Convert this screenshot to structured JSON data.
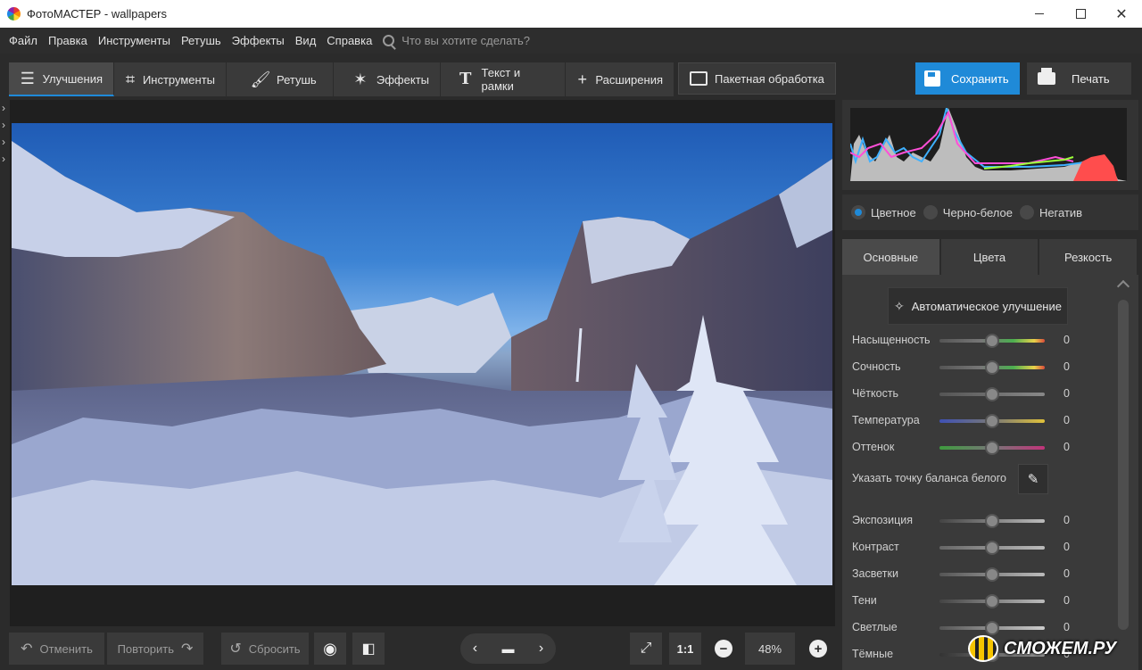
{
  "window": {
    "title": "ФотоМАСТЕР - wallpapers"
  },
  "menu": {
    "items": [
      "Файл",
      "Правка",
      "Инструменты",
      "Ретушь",
      "Эффекты",
      "Вид",
      "Справка"
    ],
    "search_placeholder": "Что вы хотите сделать?"
  },
  "tabs": [
    {
      "label": "Улучшения",
      "icon": "sliders-icon",
      "active": true
    },
    {
      "label": "Инструменты",
      "icon": "crop-icon"
    },
    {
      "label": "Ретушь",
      "icon": "brush-icon"
    },
    {
      "label": "Эффекты",
      "icon": "magic-wand-icon"
    },
    {
      "label": "Текст и рамки",
      "icon": "text-icon"
    },
    {
      "label": "Расширения",
      "icon": "plus-icon"
    }
  ],
  "toolbar": {
    "batch_label": "Пакетная обработка",
    "save_label": "Сохранить",
    "print_label": "Печать",
    "accent_color": "#1f8ad8"
  },
  "bottom": {
    "undo_label": "Отменить",
    "redo_label": "Повторить",
    "reset_label": "Сбросить",
    "ratio_label": "1:1",
    "zoom_value": "48%"
  },
  "panel": {
    "modes": [
      {
        "label": "Цветное",
        "selected": true
      },
      {
        "label": "Черно-белое",
        "selected": false
      },
      {
        "label": "Негатив",
        "selected": false
      }
    ],
    "tabs": [
      "Основные",
      "Цвета",
      "Резкость"
    ],
    "auto_label": "Автоматическое улучшение",
    "white_balance_label": "Указать точку баланса белого",
    "color_sliders": [
      {
        "label": "Насыщенность",
        "value": "0",
        "gradient": "linear-gradient(90deg,#555,#777 40%,#4caf50 70%,#e8d14a 90%,#d94a3a)"
      },
      {
        "label": "Сочность",
        "value": "0",
        "gradient": "linear-gradient(90deg,#555,#777 40%,#4caf50 70%,#e8d14a 90%,#d94a3a)"
      },
      {
        "label": "Чёткость",
        "value": "0",
        "gradient": "linear-gradient(90deg,#555,#888)"
      },
      {
        "label": "Температура",
        "value": "0",
        "gradient": "linear-gradient(90deg,#3f51b5,#777 50%,#e0c13a)"
      },
      {
        "label": "Оттенок",
        "value": "0",
        "gradient": "linear-gradient(90deg,#3e9b3e,#777 50%,#c2337a)"
      }
    ],
    "tone_sliders": [
      {
        "label": "Экспозиция",
        "value": "0",
        "gradient": "linear-gradient(90deg,#444,#bbb)"
      },
      {
        "label": "Контраст",
        "value": "0",
        "gradient": "linear-gradient(90deg,#666,#bbb)"
      },
      {
        "label": "Засветки",
        "value": "0",
        "gradient": "linear-gradient(90deg,#555,#bbb)"
      },
      {
        "label": "Тени",
        "value": "0",
        "gradient": "linear-gradient(90deg,#444,#bbb)"
      },
      {
        "label": "Светлые",
        "value": "0",
        "gradient": "linear-gradient(90deg,#555,#ccc)"
      },
      {
        "label": "Тёмные",
        "value": "0",
        "gradient": "linear-gradient(90deg,#333,#999)"
      }
    ],
    "slider_level": 0.5
  },
  "watermark": "СМОЖЕМ.РУ"
}
